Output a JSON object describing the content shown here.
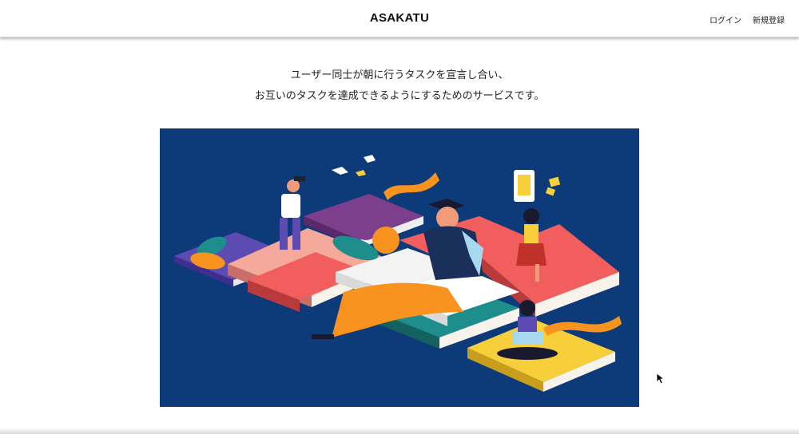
{
  "header": {
    "brand": "ASAKATU",
    "nav": {
      "login": "ログイン",
      "signup": "新規登録"
    }
  },
  "intro": {
    "line1": "ユーザー同士が朝に行うタスクを宣言し合い、",
    "line2": "お互いのタスクを達成できるようにするためのサービスです。"
  },
  "colors": {
    "hero_background": "#0d3b7a",
    "book_pink": "#f4a99a",
    "book_red": "#f25d5d",
    "book_purple": "#7b3f8c",
    "book_yellow": "#f7cf3b",
    "book_teal": "#1e8e8c",
    "accent_orange": "#f7931e"
  }
}
